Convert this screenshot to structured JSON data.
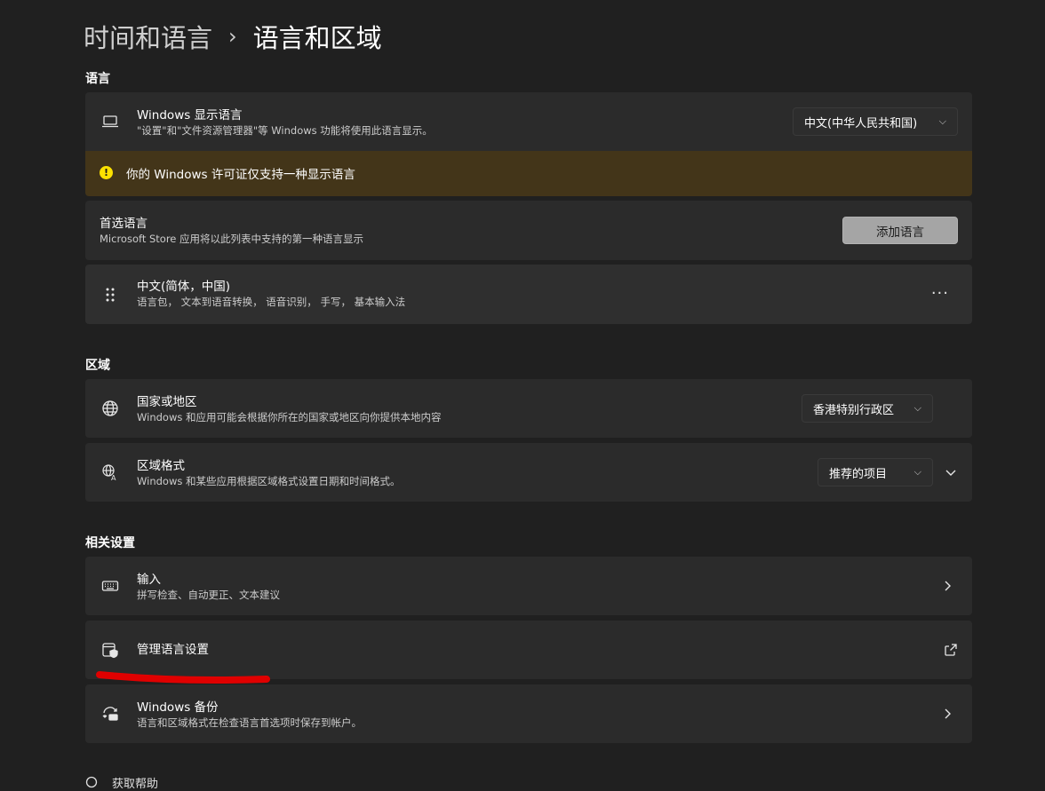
{
  "breadcrumb": {
    "parent": "时间和语言",
    "separator": "›",
    "current": "语言和区域"
  },
  "sections": {
    "language": "语言",
    "region": "区域",
    "related": "相关设置"
  },
  "display_language": {
    "title": "Windows 显示语言",
    "subtitle": "\"设置\"和\"文件资源管理器\"等 Windows 功能将使用此语言显示。",
    "value": "中文(中华人民共和国)"
  },
  "warning": {
    "icon": "!",
    "text": "你的 Windows 许可证仅支持一种显示语言"
  },
  "preferred": {
    "title": "首选语言",
    "subtitle": "Microsoft Store 应用将以此列表中支持的第一种语言显示",
    "button": "添加语言"
  },
  "language_item": {
    "title": "中文(简体，中国)",
    "subtitle": "语言包， 文本到语音转换， 语音识别， 手写， 基本输入法",
    "more": "···"
  },
  "country": {
    "title": "国家或地区",
    "subtitle": "Windows 和应用可能会根据你所在的国家或地区向你提供本地内容",
    "value": "香港特别行政区"
  },
  "format": {
    "title": "区域格式",
    "subtitle": "Windows 和某些应用根据区域格式设置日期和时间格式。",
    "value": "推荐的项目"
  },
  "typing": {
    "title": "输入",
    "subtitle": "拼写检查、自动更正、文本建议"
  },
  "admin": {
    "title": "管理语言设置"
  },
  "backup": {
    "title": "Windows 备份",
    "subtitle": "语言和区域格式在检查语言首选项时保存到帐户。"
  },
  "help": {
    "text": "获取帮助"
  },
  "colors": {
    "background": "#202020",
    "card": "#2b2b2b",
    "warning_bg": "#433519",
    "warning_icon": "#fce100",
    "annotation": "#e00000"
  }
}
